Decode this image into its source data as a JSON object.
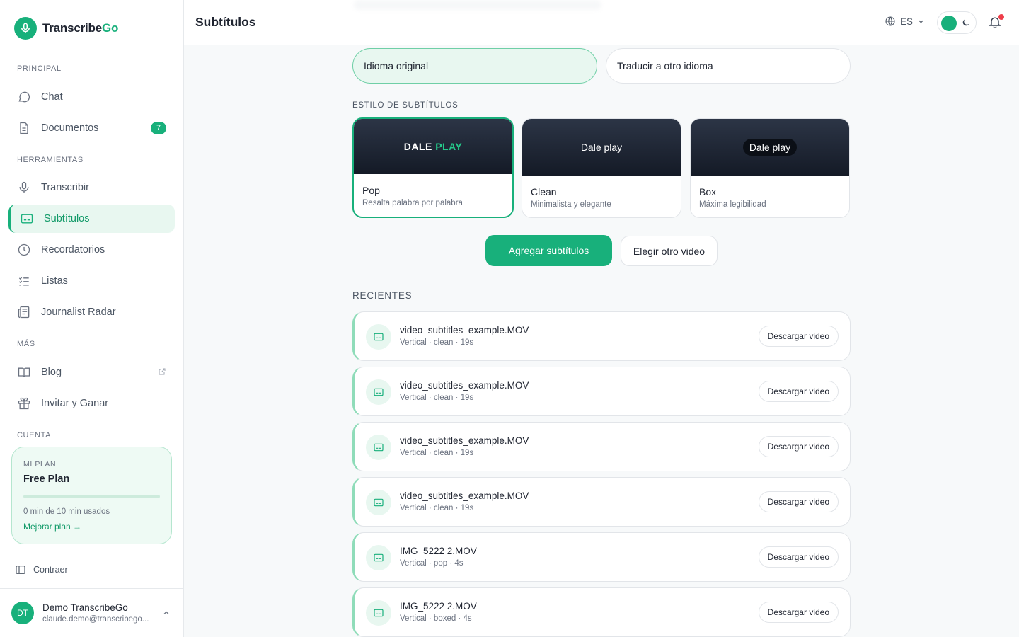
{
  "brand": {
    "name_prefix": "Transcribe",
    "name_suffix": "Go"
  },
  "header": {
    "title": "Subtítulos",
    "language": "ES"
  },
  "sidebar": {
    "sections": {
      "principal": "PRINCIPAL",
      "herramientas": "HERRAMIENTAS",
      "mas": "MÁS",
      "cuenta": "CUENTA"
    },
    "items": {
      "chat": "Chat",
      "documentos": "Documentos",
      "documentos_badge": "7",
      "transcribir": "Transcribir",
      "subtitulos": "Subtítulos",
      "recordatorios": "Recordatorios",
      "listas": "Listas",
      "journalist_radar": "Journalist Radar",
      "blog": "Blog",
      "invitar": "Invitar y Ganar"
    },
    "plan": {
      "label": "MI PLAN",
      "name": "Free Plan",
      "usage_fraction": 0,
      "usage_text": "0 min de 10 min usados",
      "upgrade_link": "Mejorar plan →"
    },
    "collapse_label": "Contraer",
    "user": {
      "initials": "DT",
      "name": "Demo TranscribeGo",
      "email": "claude.demo@transcribego..."
    }
  },
  "language_options": {
    "original": "Idioma original",
    "translate": "Traducir a otro idioma",
    "selected": "original"
  },
  "styles": {
    "label": "ESTILO DE SUBTÍTULOS",
    "selected": "pop",
    "cards": [
      {
        "id": "pop",
        "preview_main": "DALE",
        "preview_highlight": "PLAY",
        "name": "Pop",
        "description": "Resalta palabra por palabra"
      },
      {
        "id": "clean",
        "preview": "Dale play",
        "name": "Clean",
        "description": "Minimalista y elegante"
      },
      {
        "id": "box",
        "preview": "Dale play",
        "name": "Box",
        "description": "Máxima legibilidad"
      }
    ]
  },
  "actions": {
    "primary": "Agregar subtítulos",
    "secondary": "Elegir otro video"
  },
  "recent": {
    "label": "RECIENTES",
    "download_label": "Descargar video",
    "items": [
      {
        "title": "video_subtitles_example.MOV",
        "meta": "Vertical · clean · 19s"
      },
      {
        "title": "video_subtitles_example.MOV",
        "meta": "Vertical · clean · 19s"
      },
      {
        "title": "video_subtitles_example.MOV",
        "meta": "Vertical · clean · 19s"
      },
      {
        "title": "video_subtitles_example.MOV",
        "meta": "Vertical · clean · 19s"
      },
      {
        "title": "IMG_5222 2.MOV",
        "meta": "Vertical · pop · 4s"
      },
      {
        "title": "IMG_5222 2.MOV",
        "meta": "Vertical · boxed · 4s"
      }
    ]
  },
  "colors": {
    "accent": "#18b07b",
    "accent_light": "#e8f7f0",
    "notification": "#ef3e4a"
  }
}
